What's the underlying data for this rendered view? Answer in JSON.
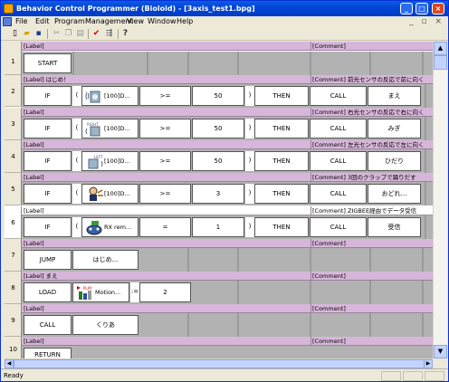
{
  "window": {
    "title": "Behavior Control Programmer (Bioloid) - [3axis_test1.bpg]",
    "minimize": "_",
    "maximize": "□",
    "close": "×",
    "mdi_controls": "_ ▫ ×"
  },
  "menu": [
    "File",
    "Edit",
    "Program",
    "Management",
    "View",
    "Window",
    "Help"
  ],
  "toolbar": [
    "new-file-icon",
    "open-folder-icon",
    "save-icon",
    "cut-icon",
    "copy-icon",
    "paste-icon",
    "check-icon",
    "compile-icon",
    "help-icon"
  ],
  "rows": [
    {
      "num": "1",
      "label": "[Label]",
      "comment": "[Comment]",
      "cells": {
        "a": "START"
      }
    },
    {
      "num": "2",
      "label": "[Label] はじめ！",
      "comment": "[Comment] 前光センサの反応で前に向く",
      "cells": {
        "kw": "IF",
        "open": "(",
        "sensor": "[100]D...",
        "op": ">=",
        "val": "50",
        "close": ")",
        "then": "THEN",
        "act": "CALL",
        "tgt": "まえ"
      }
    },
    {
      "num": "3",
      "label": "[Label]",
      "comment": "[Comment] 右光センサの反応で右に向く",
      "cells": {
        "kw": "IF",
        "open": "(",
        "sensor": "[100]D...",
        "op": ">=",
        "val": "50",
        "close": ")",
        "then": "THEN",
        "act": "CALL",
        "tgt": "みぎ"
      }
    },
    {
      "num": "4",
      "label": "[Label]",
      "comment": "[Comment] 左光センサの反応で左に向く",
      "cells": {
        "kw": "IF",
        "open": "(",
        "sensor": "[100]D...",
        "op": ">=",
        "val": "50",
        "close": ")",
        "then": "THEN",
        "act": "CALL",
        "tgt": "ひだり"
      }
    },
    {
      "num": "5",
      "label": "[Label]",
      "comment": "[Comment] 3回のクラップで踊りだす",
      "cells": {
        "kw": "IF",
        "open": "(",
        "sensor": "[100]D...",
        "op": ">=",
        "val": "3",
        "close": ")",
        "then": "THEN",
        "act": "CALL",
        "tgt": "おどれ..."
      }
    },
    {
      "num": "6",
      "label": "[Label]",
      "comment": "[Comment] ZIGBEE経由でデータ受信",
      "cells": {
        "kw": "IF",
        "open": "(",
        "sensor": "RX rem...",
        "op": "=",
        "val": "1",
        "close": ")",
        "then": "THEN",
        "act": "CALL",
        "tgt": "受信"
      }
    },
    {
      "num": "7",
      "label": "[Label]",
      "comment": "[Comment]",
      "cells": {
        "a": "JUMP",
        "b": "はじめ..."
      }
    },
    {
      "num": "8",
      "label": "[Label] まえ",
      "comment": "[Comment]",
      "cells": {
        "a": "LOAD",
        "motion": "Motion...",
        "assign": ":=",
        "val": "2"
      }
    },
    {
      "num": "9",
      "label": "[Label]",
      "comment": "[Comment]",
      "cells": {
        "a": "CALL",
        "b": "くりあ"
      }
    },
    {
      "num": "10",
      "label": "[Label]",
      "comment": "[Comment]",
      "cells": {
        "a": "RETURN"
      }
    }
  ],
  "sensor_icon_labels": {
    "r3": "RIGHT",
    "r4": "LEFT",
    "r8": "PLAY"
  },
  "status": "Ready"
}
